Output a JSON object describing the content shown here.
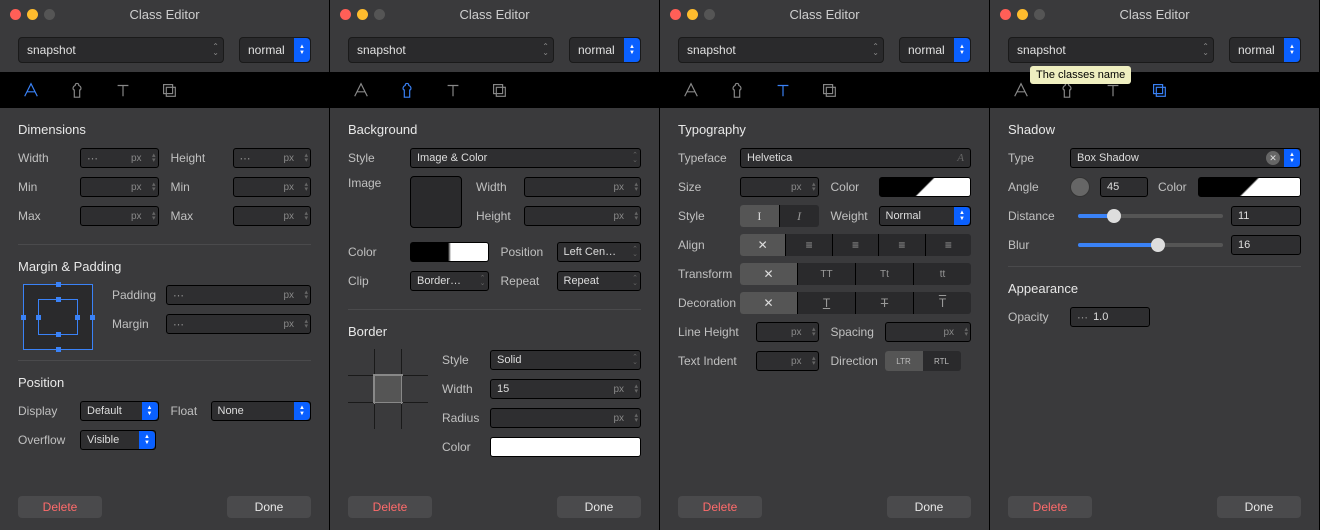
{
  "common": {
    "window_title": "Class Editor",
    "classname": "snapshot",
    "mode": "normal",
    "delete": "Delete",
    "done": "Done",
    "px": "px"
  },
  "tooltip": "The classes name",
  "p1": {
    "dimensions_title": "Dimensions",
    "width": "Width",
    "height": "Height",
    "min": "Min",
    "max": "Max",
    "mp_title": "Margin & Padding",
    "padding": "Padding",
    "margin": "Margin",
    "pos_title": "Position",
    "display": "Display",
    "display_val": "Default",
    "float": "Float",
    "float_val": "None",
    "overflow": "Overflow",
    "overflow_val": "Visible"
  },
  "p2": {
    "bg_title": "Background",
    "style": "Style",
    "style_val": "Image & Color",
    "image": "Image",
    "width": "Width",
    "height": "Height",
    "color": "Color",
    "position": "Position",
    "position_val": "Left Cen…",
    "clip": "Clip",
    "clip_val": "Border…",
    "repeat": "Repeat",
    "repeat_val": "Repeat",
    "border_title": "Border",
    "bstyle": "Style",
    "bstyle_val": "Solid",
    "bwidth": "Width",
    "bwidth_val": "15",
    "bradius": "Radius",
    "bcolor": "Color"
  },
  "p3": {
    "title": "Typography",
    "typeface": "Typeface",
    "typeface_val": "Helvetica",
    "size": "Size",
    "color": "Color",
    "style": "Style",
    "weight": "Weight",
    "weight_val": "Normal",
    "align": "Align",
    "transform": "Transform",
    "decoration": "Decoration",
    "lineheight": "Line Height",
    "spacing": "Spacing",
    "indent": "Text Indent",
    "direction": "Direction",
    "ltr": "LTR",
    "rtl": "RTL"
  },
  "p4": {
    "shadow_title": "Shadow",
    "type": "Type",
    "type_val": "Box Shadow",
    "angle": "Angle",
    "angle_val": "45",
    "color": "Color",
    "distance": "Distance",
    "distance_val": "11",
    "blur": "Blur",
    "blur_val": "16",
    "appearance_title": "Appearance",
    "opacity": "Opacity",
    "opacity_val": "1.0"
  }
}
